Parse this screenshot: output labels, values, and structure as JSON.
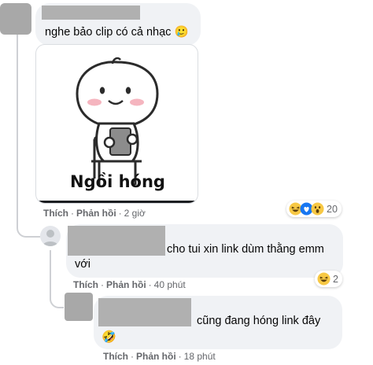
{
  "comment1": {
    "text": "nghe bảo clip có cả nhạc 🥲",
    "sticker_caption": "Ngồi hóng",
    "actions": {
      "like": "Thích",
      "reply": "Phản hồi",
      "time": "2 giờ"
    },
    "reactions": {
      "icons": [
        "haha-icon",
        "care-icon",
        "wow-icon"
      ],
      "count": "20"
    }
  },
  "reply1": {
    "text": "cho tui xin link dùm thằng emm với",
    "actions": {
      "like": "Thích",
      "reply": "Phản hồi",
      "time": "40 phút"
    },
    "reactions": {
      "icons": [
        "haha-icon"
      ],
      "count": "2"
    }
  },
  "reply2": {
    "text": "cũng đang hóng link đây",
    "emoji": "🤣",
    "actions": {
      "like": "Thích",
      "reply": "Phản hồi",
      "time": "18 phút"
    }
  },
  "colors": {
    "bubble": "#f0f2f5",
    "meta_text": "#65676b",
    "thread_line": "#ced0d4",
    "redaction": "#b0b0b0"
  }
}
